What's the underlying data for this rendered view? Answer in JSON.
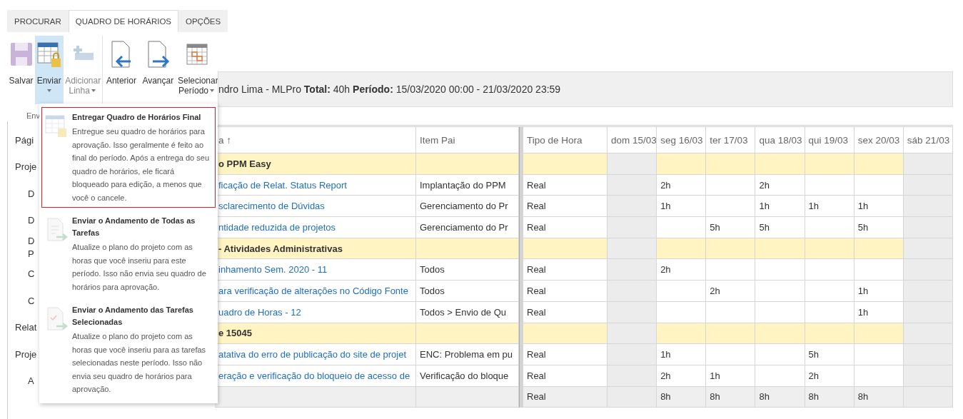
{
  "ribbon": {
    "tabs": [
      {
        "label": "PROCURAR",
        "selected": false
      },
      {
        "label": "QUADRO DE HORÁRIOS",
        "selected": true
      },
      {
        "label": "OPÇÕES",
        "selected": false
      }
    ],
    "commands": [
      {
        "kind": "save",
        "label": "Salvar",
        "disabled": false,
        "has_menu": false,
        "selected": false
      },
      {
        "kind": "submit",
        "label": "Enviar",
        "disabled": false,
        "has_menu": true,
        "selected": true
      },
      {
        "kind": "add_row",
        "label": "Adicionar Linha",
        "disabled": true,
        "has_menu": true,
        "selected": false
      },
      {
        "kind": "previous",
        "label": "Anterior",
        "disabled": false,
        "has_menu": false,
        "selected": false
      },
      {
        "kind": "next",
        "label": "Avançar",
        "disabled": false,
        "has_menu": false,
        "selected": false
      },
      {
        "kind": "period",
        "label": "Selecionar Período",
        "disabled": false,
        "has_menu": true,
        "selected": false
      }
    ],
    "group_label": "Env"
  },
  "info_bar": {
    "text": "ndro Lima - MLPro **Total:** 40h **Período:** 15/03/2020 00:00 - 21/03/2020 23:59"
  },
  "menu": {
    "items": [
      {
        "kind": "final",
        "title": "Entregar Quadro de Horários Final",
        "description": "Entregue seu quadro de horários para aprovação. Isso geralmente é feito ao final do período. Após a entrega do seu quadro de horários, ele ficará bloqueado para edição, a menos que você o cancele.",
        "selected": true
      },
      {
        "kind": "all",
        "title": "Enviar o Andamento de Todas as Tarefas",
        "description": "Atualize o plano do projeto com as horas que você inseriu para este período. Isso não envia seu quadro de horários para aprovação.",
        "selected": false
      },
      {
        "kind": "selected",
        "title": "Enviar o Andamento das Tarefas Selecionadas",
        "description": "Atualize o plano do projeto com as horas que você inseriu para as tarefas selecionadas neste período. Isso não envia seu quadro de horários para aprovação.",
        "selected": false
      }
    ]
  },
  "sidebar": {
    "items": [
      {
        "label": "Pági"
      },
      {
        "label": "Proje",
        "children": [
          {
            "label": "D"
          },
          {
            "label": "D"
          },
          {
            "label": "D P"
          },
          {
            "label": "C"
          },
          {
            "label": "C"
          }
        ]
      },
      {
        "label": "Relat"
      },
      {
        "label": "Proje",
        "children": [
          {
            "label": "A"
          }
        ]
      }
    ]
  },
  "table": {
    "columns": {
      "task": "a ↑",
      "parent": "Item Pai",
      "type": "Tipo de Hora"
    },
    "days": [
      {
        "label": "dom 15/03",
        "weekend": true
      },
      {
        "label": "seg 16/03",
        "weekend": false
      },
      {
        "label": "ter 17/03",
        "weekend": false
      },
      {
        "label": "qua 18/03",
        "weekend": false
      },
      {
        "label": "qui 19/03",
        "weekend": false
      },
      {
        "label": "sex 20/03",
        "weekend": false
      },
      {
        "label": "sáb 21/03",
        "weekend": true
      }
    ],
    "rows": [
      {
        "kind": "group",
        "task": "o PPM Easy"
      },
      {
        "kind": "task",
        "task": "ficação de Relat. Status Report",
        "parent": "Implantação do PPM",
        "type": "Real",
        "hours": {
          "day_2": "2h",
          "day_4": "2h"
        }
      },
      {
        "kind": "task",
        "task": "sclarecimento de Dúvidas",
        "parent": "Gerenciamento do Pr",
        "type": "Real",
        "hours": {
          "day_2": "1h",
          "day_4": "1h",
          "day_5": "1h",
          "day_6": "1h"
        }
      },
      {
        "kind": "task",
        "task": "ntidade reduzida de projetos",
        "parent": "Gerenciamento do Pr",
        "type": "Real",
        "hours": {
          "day_3": "5h",
          "day_4": "5h",
          "day_6": "5h"
        }
      },
      {
        "kind": "group",
        "task": "- Atividades Administrativas"
      },
      {
        "kind": "task",
        "task": "inhamento Sem. 2020 - 11",
        "parent": "Todos",
        "type": "Real",
        "hours": {
          "day_2": "2h"
        }
      },
      {
        "kind": "task",
        "task": "ara verificação de alterações no Código Fonte",
        "parent": "Todos",
        "type": "Real",
        "hours": {
          "day_3": "2h",
          "day_6": "1h"
        }
      },
      {
        "kind": "task",
        "task": "uadro de Horas - 12",
        "parent": "Todos > Envio de Qu",
        "type": "Real",
        "hours": {
          "day_6": "1h"
        }
      },
      {
        "kind": "group",
        "task": "e 15045"
      },
      {
        "kind": "task",
        "task": "atativa do erro de publicação do site de projet",
        "parent": "ENC: Problema em pu",
        "type": "Real",
        "hours": {
          "day_2": "1h",
          "day_5": "5h"
        }
      },
      {
        "kind": "task",
        "task": "eração e verificação do bloqueio de acesso de",
        "parent": "Verificação do bloque",
        "type": "Real",
        "hours": {
          "day_2": "2h",
          "day_3": "1h",
          "day_5": "2h"
        }
      },
      {
        "kind": "total",
        "type": "Real",
        "hours": {
          "day_2": "8h",
          "day_3": "8h",
          "day_4": "8h",
          "day_5": "8h",
          "day_6": "8h"
        }
      }
    ]
  }
}
